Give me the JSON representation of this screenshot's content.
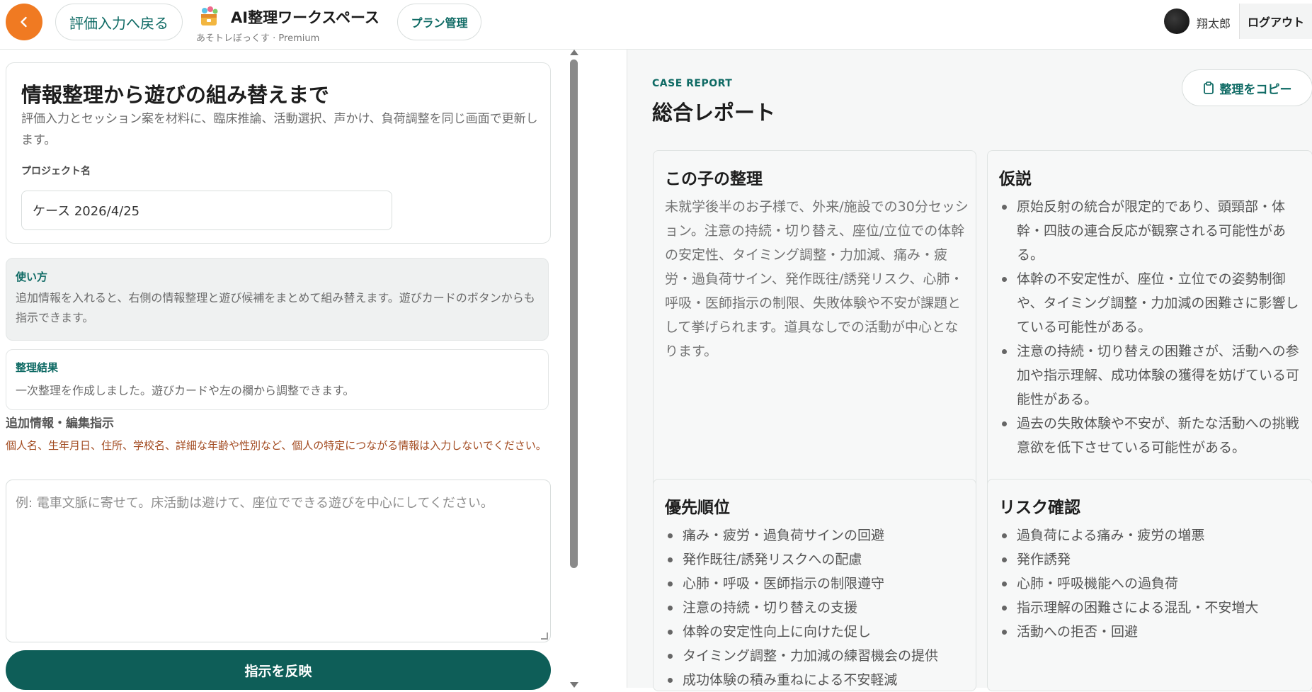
{
  "header": {
    "back_eval_label": "評価入力へ戻る",
    "app_title": "AI整理ワークスペース",
    "app_subtitle": "あそトレぼっくす · Premium",
    "plan_label": "プラン管理",
    "username": "翔太郎",
    "logout_label": "ログアウト"
  },
  "intro": {
    "title": "情報整理から遊びの組み替えまで",
    "description": "評価入力とセッション案を材料に、臨床推論、活動選択、声かけ、負荷調整を同じ画面で更新します。",
    "project_label": "プロジェクト名",
    "project_value": "ケース 2026/4/25"
  },
  "howto": {
    "title": "使い方",
    "body": "追加情報を入れると、右側の情報整理と遊び候補をまとめて組み替えます。遊びカードのボタンからも指示できます。"
  },
  "result": {
    "title": "整理結果",
    "body": "一次整理を作成しました。遊びカードや左の欄から調整できます。"
  },
  "instructions": {
    "label": "追加情報・編集指示",
    "warning": "個人名、生年月日、住所、学校名、詳細な年齢や性別など、個人の特定につながる情報は入力しないでください。",
    "placeholder": "例: 電車文脈に寄せて。床活動は避けて、座位でできる遊びを中心にしてください。",
    "apply_label": "指示を反映"
  },
  "report": {
    "kicker": "CASE REPORT",
    "title": "総合レポート",
    "copy_label": "整理をコピー",
    "summary": {
      "title": "この子の整理",
      "body": "未就学後半のお子様で、外来/施設での30分セッション。注意の持続・切り替え、座位/立位での体幹の安定性、タイミング調整・力加減、痛み・疲労・過負荷サイン、発作既往/誘発リスク、心肺・呼吸・医師指示の制限、失敗体験や不安が課題として挙げられます。道具なしでの活動が中心となります。"
    },
    "hypothesis": {
      "title": "仮説",
      "items": [
        "原始反射の統合が限定的であり、頭頸部・体幹・四肢の連合反応が観察される可能性がある。",
        "体幹の不安定性が、座位・立位での姿勢制御や、タイミング調整・力加減の困難さに影響している可能性がある。",
        "注意の持続・切り替えの困難さが、活動への参加や指示理解、成功体験の獲得を妨げている可能性がある。",
        "過去の失敗体験や不安が、新たな活動への挑戦意欲を低下させている可能性がある。"
      ]
    },
    "priority": {
      "title": "優先順位",
      "items": [
        "痛み・疲労・過負荷サインの回避",
        "発作既往/誘発リスクへの配慮",
        "心肺・呼吸・医師指示の制限遵守",
        "注意の持続・切り替えの支援",
        "体幹の安定性向上に向けた促し",
        "タイミング調整・力加減の練習機会の提供",
        "成功体験の積み重ねによる不安軽減"
      ]
    },
    "risk": {
      "title": "リスク確認",
      "items": [
        "過負荷による痛み・疲労の増悪",
        "発作誘発",
        "心肺・呼吸機能への過負荷",
        "指示理解の困難さによる混乱・不安増大",
        "活動への拒否・回避"
      ]
    }
  },
  "colors": {
    "accent_orange": "#f07a22",
    "brand_teal": "#0e6a64",
    "button_teal": "#0e5e58",
    "warning": "#a24a1f"
  }
}
